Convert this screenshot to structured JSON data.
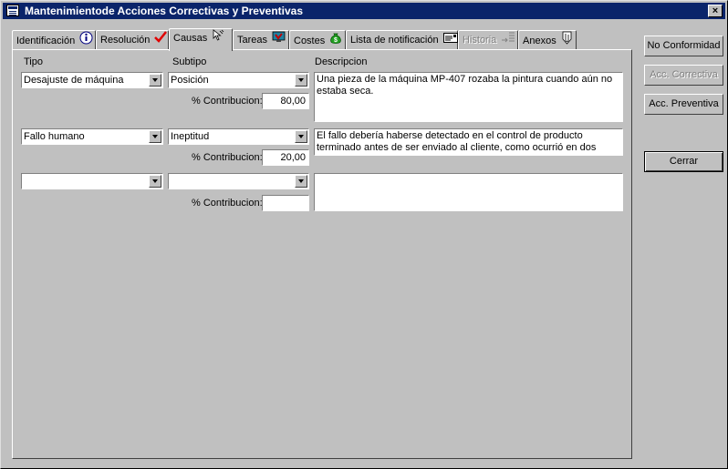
{
  "window": {
    "title": "Mantenimientode Acciones Correctivas y Preventivas",
    "close_label": "×"
  },
  "tabs": [
    {
      "label": "Identificación",
      "icon": "info-icon"
    },
    {
      "label": "Resolución",
      "icon": "checkmark-icon"
    },
    {
      "label": "Causas",
      "icon": "pointer-icon",
      "active": true
    },
    {
      "label": "Tareas",
      "icon": "tasks-icon"
    },
    {
      "label": "Costes",
      "icon": "money-bag-icon"
    },
    {
      "label": "Lista de notificación",
      "icon": "envelope-icon"
    },
    {
      "label": "Historia",
      "icon": "history-icon",
      "disabled": true
    },
    {
      "label": "Anexos",
      "icon": "attachment-icon"
    }
  ],
  "columns": {
    "tipo": "Tipo",
    "subtipo": "Subtipo",
    "descripcion": "Descripcion"
  },
  "contribucion_label": "% Contribucion:",
  "causes": [
    {
      "tipo": "Desajuste de máquina",
      "subtipo": "Posición",
      "contribucion": "80,00",
      "descripcion": "Una pieza de la máquina MP-407 rozaba la pintura cuando aún no estaba seca."
    },
    {
      "tipo": "Fallo humano",
      "subtipo": "Ineptitud",
      "contribucion": "20,00",
      "descripcion": "El fallo debería haberse detectado en el control de producto terminado antes de ser enviado al cliente, como ocurrió en dos ocasiones.."
    },
    {
      "tipo": "",
      "subtipo": "",
      "contribucion": "",
      "descripcion": ""
    }
  ],
  "buttons": {
    "no_conformidad": "No Conformidad",
    "acc_correctiva": "Acc. Correctiva",
    "acc_preventiva": "Acc. Preventiva",
    "cerrar": "Cerrar"
  }
}
